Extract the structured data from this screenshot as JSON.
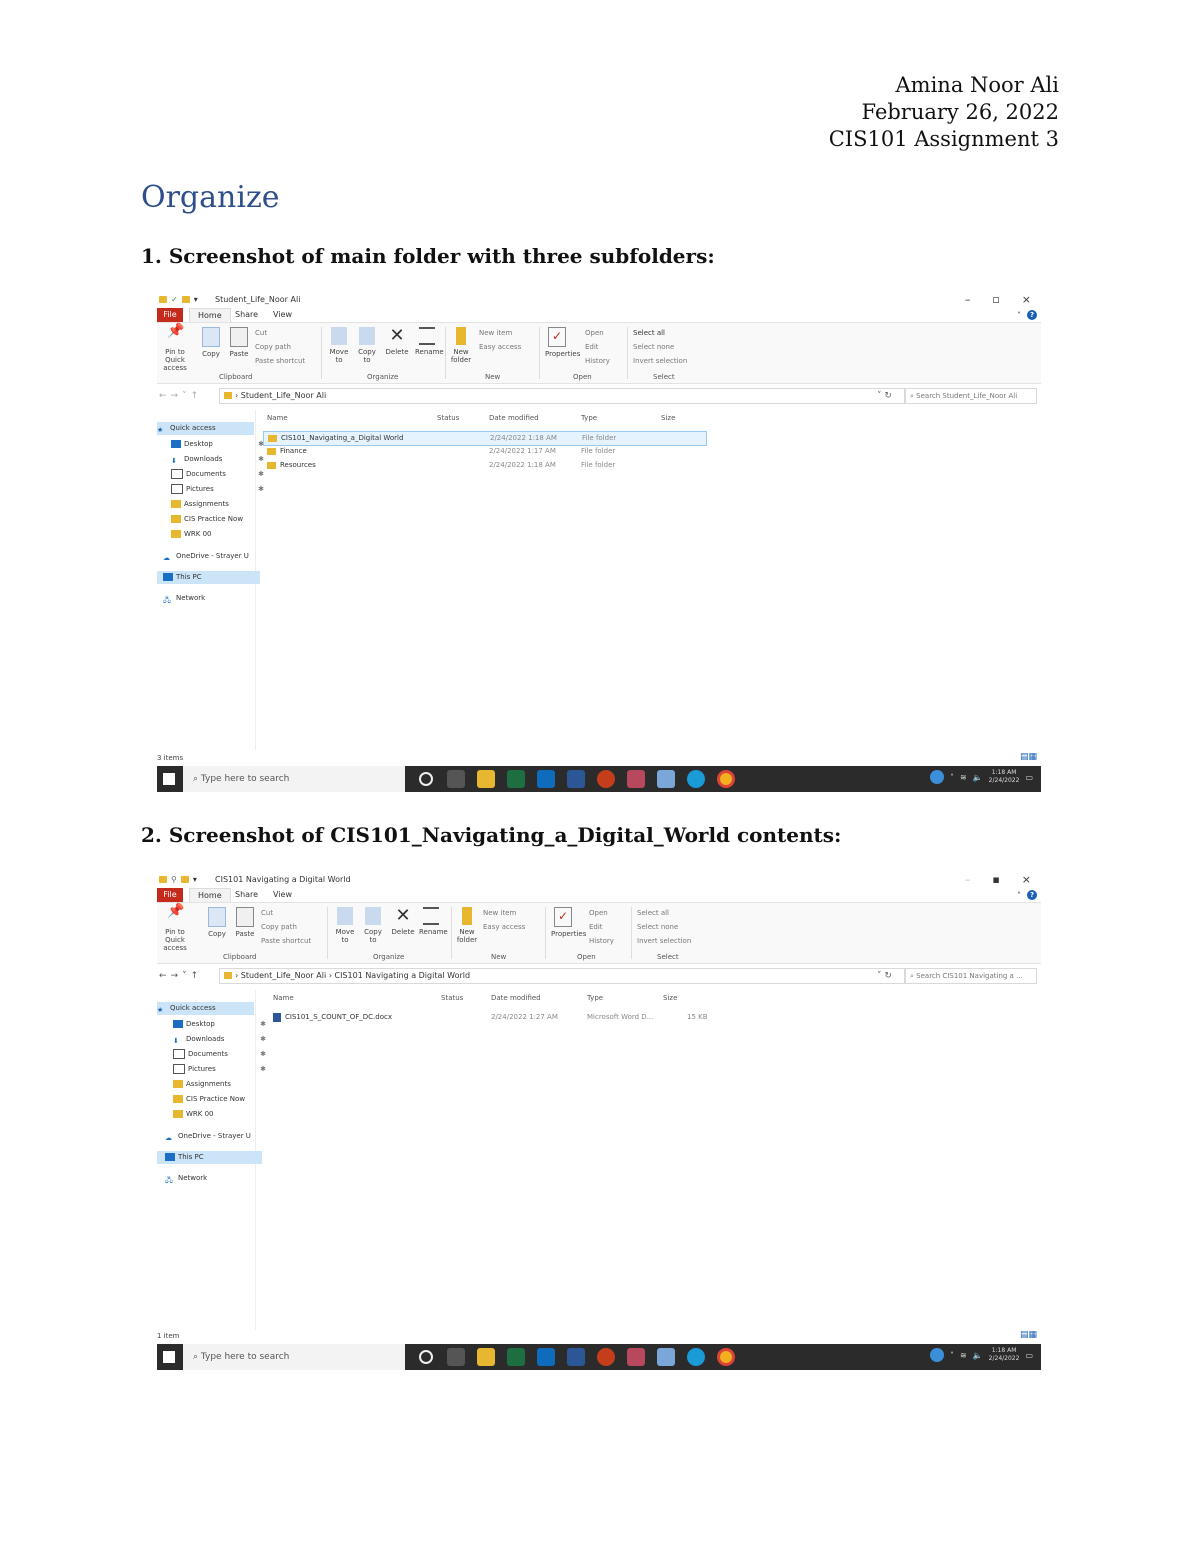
{
  "header": {
    "author": "Amina Noor Ali",
    "date": "February 26, 2022",
    "course": "CIS101 Assignment 3"
  },
  "heading": "Organize",
  "captions": [
    "1. Screenshot of main folder with three subfolders:",
    "2. Screenshot of CIS101_Navigating_a_Digital_World contents:"
  ],
  "explorer": {
    "menu": {
      "file": "File",
      "home": "Home",
      "share": "Share",
      "view": "View"
    },
    "ribbon": {
      "pin": "Pin to Quick access",
      "copy": "Copy",
      "paste": "Paste",
      "cut": "Cut",
      "copy_path": "Copy path",
      "paste_shortcut": "Paste shortcut",
      "move_to": "Move to",
      "copy_to": "Copy to",
      "delete": "Delete",
      "rename": "Rename",
      "new_folder": "New folder",
      "new_item": "New item",
      "easy_access": "Easy access",
      "properties": "Properties",
      "open": "Open",
      "edit": "Edit",
      "history": "History",
      "select_all": "Select all",
      "select_none": "Select none",
      "invert_selection": "Invert selection",
      "groups": {
        "clipboard": "Clipboard",
        "organize": "Organize",
        "new": "New",
        "open": "Open",
        "select": "Select"
      }
    },
    "nav": {
      "quick_access": "Quick access",
      "desktop": "Desktop",
      "downloads": "Downloads",
      "documents": "Documents",
      "pictures": "Pictures",
      "assignments": "Assignments",
      "cis_practice": "CIS Practice Now",
      "wrk": "WRK 00",
      "onedrive": "OneDrive - Strayer U",
      "this_pc": "This PC",
      "network": "Network"
    },
    "columns": {
      "name": "Name",
      "status": "Status",
      "date": "Date modified",
      "type": "Type",
      "size": "Size"
    },
    "taskbar": {
      "search_placeholder": "Type here to search",
      "time": "1:18 AM",
      "date": "2/24/2022"
    }
  },
  "shot1": {
    "title": "Student_Life_Noor Ali",
    "address": "Student_Life_Noor Ali",
    "search": "Search Student_Life_Noor Ali",
    "status": "3 items",
    "rows": [
      {
        "name": "CIS101_Navigating_a_Digital World",
        "date": "2/24/2022 1:18 AM",
        "type": "File folder"
      },
      {
        "name": "Finance",
        "date": "2/24/2022 1:17 AM",
        "type": "File folder"
      },
      {
        "name": "Resources",
        "date": "2/24/2022 1:18 AM",
        "type": "File folder"
      }
    ]
  },
  "shot2": {
    "title": "CIS101 Navigating a Digital World",
    "address_root": "Student_Life_Noor Ali",
    "address_leaf": "CIS101 Navigating a Digital World",
    "search": "Search CIS101 Navigating a ...",
    "status": "1 item",
    "rows": [
      {
        "name": "CIS101_S_COUNT_OF_DC.docx",
        "date": "2/24/2022 1:27 AM",
        "type": "Microsoft Word D...",
        "size": "15 KB"
      }
    ]
  }
}
